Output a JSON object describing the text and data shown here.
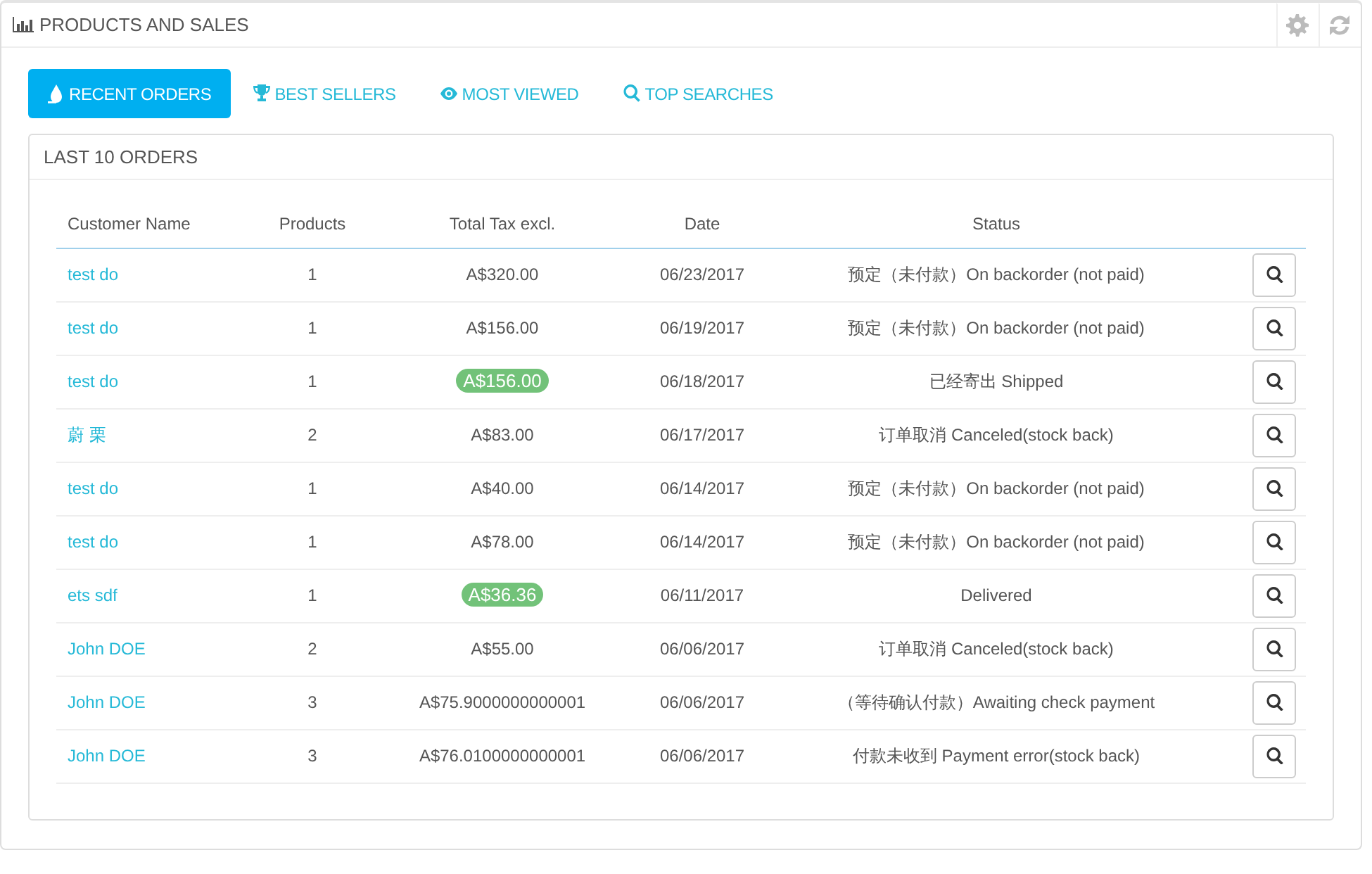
{
  "panel": {
    "title": "PRODUCTS AND SALES"
  },
  "tabs": [
    {
      "label": "RECENT ORDERS",
      "selected": true
    },
    {
      "label": "BEST SELLERS",
      "selected": false
    },
    {
      "label": "MOST VIEWED",
      "selected": false
    },
    {
      "label": "TOP SEARCHES",
      "selected": false
    }
  ],
  "orders_card": {
    "title": "LAST 10 ORDERS"
  },
  "table": {
    "columns": [
      "Customer Name",
      "Products",
      "Total Tax excl.",
      "Date",
      "Status"
    ],
    "rows": [
      {
        "customer": "test do",
        "products": "1",
        "total": "A$320.00",
        "highlighted": false,
        "date": "06/23/2017",
        "status": "预定（未付款）On backorder (not paid)"
      },
      {
        "customer": "test do",
        "products": "1",
        "total": "A$156.00",
        "highlighted": false,
        "date": "06/19/2017",
        "status": "预定（未付款）On backorder (not paid)"
      },
      {
        "customer": "test do",
        "products": "1",
        "total": "A$156.00",
        "highlighted": true,
        "date": "06/18/2017",
        "status": "已经寄出 Shipped"
      },
      {
        "customer": "蔚 栗",
        "products": "2",
        "total": "A$83.00",
        "highlighted": false,
        "date": "06/17/2017",
        "status": "订单取消 Canceled(stock back)"
      },
      {
        "customer": "test do",
        "products": "1",
        "total": "A$40.00",
        "highlighted": false,
        "date": "06/14/2017",
        "status": "预定（未付款）On backorder (not paid)"
      },
      {
        "customer": "test do",
        "products": "1",
        "total": "A$78.00",
        "highlighted": false,
        "date": "06/14/2017",
        "status": "预定（未付款）On backorder (not paid)"
      },
      {
        "customer": "ets sdf",
        "products": "1",
        "total": "A$36.36",
        "highlighted": true,
        "date": "06/11/2017",
        "status": "Delivered"
      },
      {
        "customer": "John DOE",
        "products": "2",
        "total": "A$55.00",
        "highlighted": false,
        "date": "06/06/2017",
        "status": "订单取消 Canceled(stock back)"
      },
      {
        "customer": "John DOE",
        "products": "3",
        "total": "A$75.9000000000001",
        "highlighted": false,
        "date": "06/06/2017",
        "status": "（等待确认付款）Awaiting check payment"
      },
      {
        "customer": "John DOE",
        "products": "3",
        "total": "A$76.0100000000001",
        "highlighted": false,
        "date": "06/06/2017",
        "status": "付款未收到 Payment error(stock back)"
      }
    ]
  }
}
